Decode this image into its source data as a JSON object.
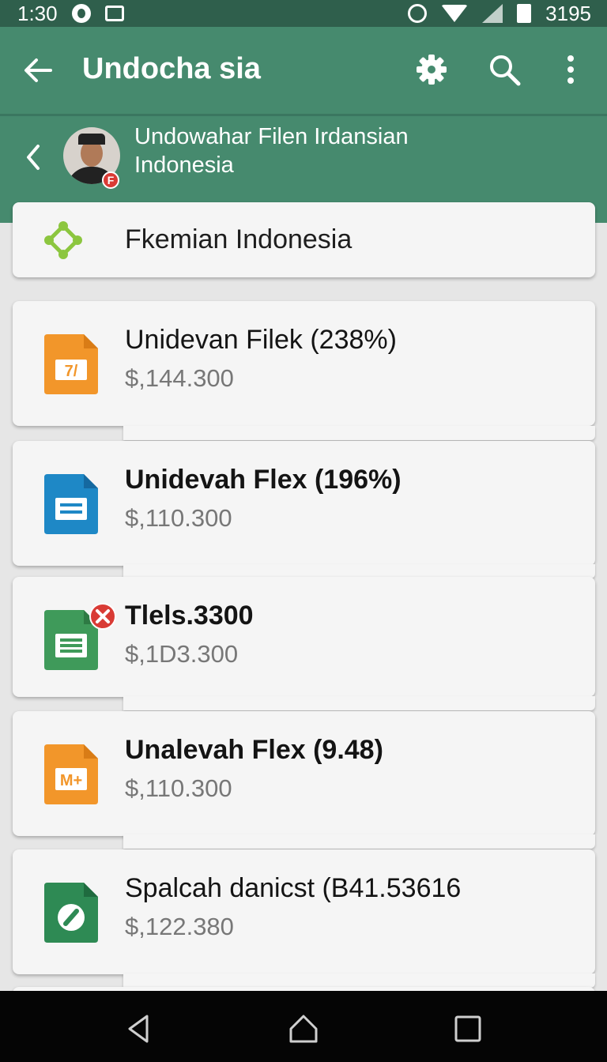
{
  "status_bar": {
    "time": "1:30",
    "battery_text": "3195"
  },
  "app_bar": {
    "title": "Undocha sia",
    "icons": [
      "back-arrow-icon",
      "gear-icon",
      "search-icon",
      "more-vert-icon"
    ]
  },
  "sub_header": {
    "title": "Undowahar Filen Irdansian Indonesia",
    "badge": "F"
  },
  "section": {
    "title": "Fkemian Indonesia",
    "icon_color": "#8cc63f"
  },
  "items": [
    {
      "title": "Unidevan Filek (238%)",
      "price": "$,144.300",
      "icon_color": "#f2962a",
      "icon": "slides-file-icon"
    },
    {
      "title": "Unidevah Flex (196%)",
      "price": "$,110.300",
      "icon_color": "#1e88c6",
      "icon": "docs-file-icon"
    },
    {
      "title": "Tlels.3300",
      "price": "$,1D3.300",
      "icon_color": "#3f9a5a",
      "icon": "sheets-file-icon"
    },
    {
      "title": "Unalevah Flex (9.48)",
      "price": "$,110.300",
      "icon_color": "#f2962a",
      "icon": "forms-file-icon"
    },
    {
      "title": "Spalcah danicst (B41.53616",
      "price": "$,122.380",
      "icon_color": "#2e8a54",
      "icon": "edit-file-icon"
    }
  ],
  "colors": {
    "status_bar": "#2f5f4c",
    "app_bar": "#468a6e",
    "background": "#e6e6e6",
    "card": "#f5f5f5"
  }
}
